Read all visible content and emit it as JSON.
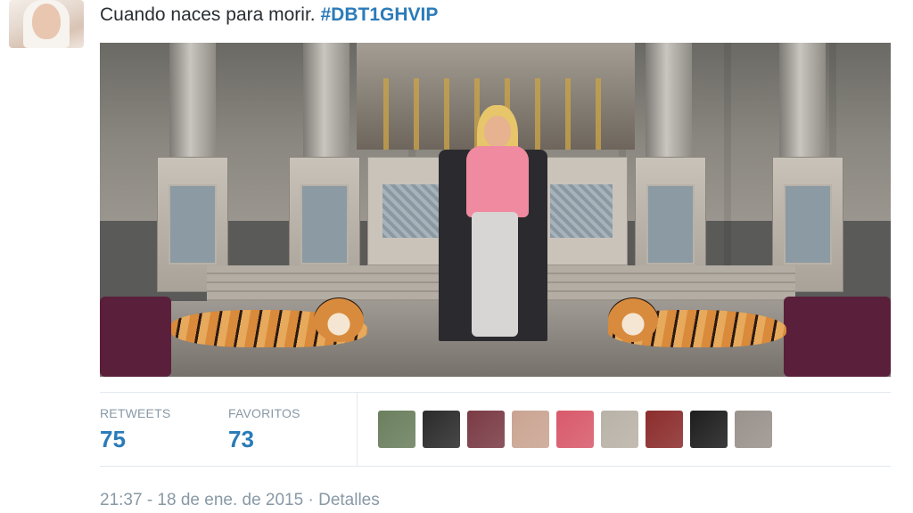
{
  "tweet": {
    "text": "Cuando naces para morir.",
    "hashtag": "#DBT1GHVIP"
  },
  "stats": {
    "retweets_label": "RETWEETS",
    "retweets_count": "75",
    "favorites_label": "FAVORITOS",
    "favorites_count": "73"
  },
  "favorited_by_avatars": [
    {
      "color": "#6b7f5e"
    },
    {
      "color": "#2b2b2b"
    },
    {
      "color": "#7a3b45"
    },
    {
      "color": "#caa492"
    },
    {
      "color": "#d85a6b"
    },
    {
      "color": "#b9b2a7"
    },
    {
      "color": "#8c2d2d"
    },
    {
      "color": "#1e1e1e"
    },
    {
      "color": "#9a928c"
    }
  ],
  "meta": {
    "timestamp": "21:37 - 18 de ene. de 2015",
    "separator": "·",
    "details_link": "Detalles"
  },
  "colors": {
    "link": "#2b7bb9",
    "muted": "#8899a6",
    "text": "#292f33",
    "divider": "#e1e8ed"
  }
}
